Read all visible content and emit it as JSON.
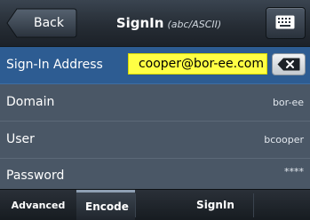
{
  "header": {
    "back_label": "Back",
    "title": "SignIn",
    "subtitle": "(abc/ASCII)",
    "keyboard_icon": "keyboard-icon"
  },
  "form": {
    "signin_address": {
      "label": "Sign-In Address",
      "value": "cooper@bor-ee.com",
      "clear_icon": "backspace-clear-icon"
    },
    "domain": {
      "label": "Domain",
      "value": "bor-ee"
    },
    "user": {
      "label": "User",
      "value": "bcooper"
    },
    "password": {
      "label": "Password",
      "value": "****"
    }
  },
  "tabs": {
    "advanced": "Advanced",
    "encode": "Encode",
    "signin": "SignIn"
  },
  "colors": {
    "header_bg": "#262d35",
    "row_bg": "#4a5766",
    "active_row_bg": "#2d5c92",
    "field_highlight": "#ffff44"
  }
}
